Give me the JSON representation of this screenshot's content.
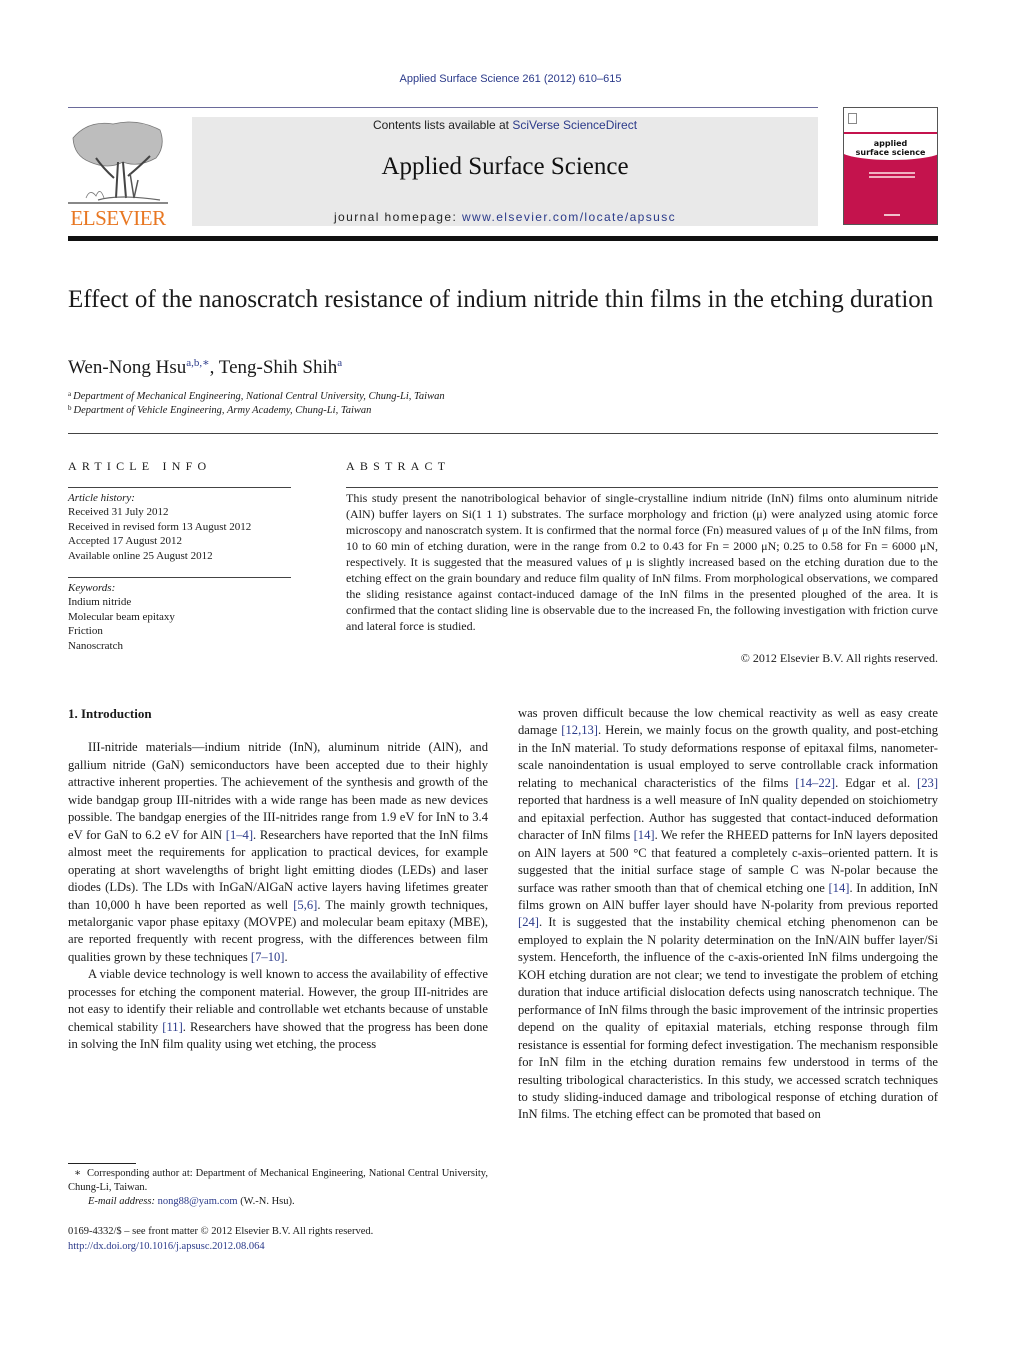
{
  "running_head": "Applied Surface Science 261 (2012) 610–615",
  "masthead": {
    "contents_prefix": "Contents lists available at ",
    "contents_link": "SciVerse ScienceDirect",
    "journal_title": "Applied Surface Science",
    "homepage_prefix": "journal homepage: ",
    "homepage_link": "www.elsevier.com/locate/apsusc",
    "publisher_logo_text": "ELSEVIER",
    "cover_title_line1": "applied",
    "cover_title_line2": "surface science"
  },
  "colors": {
    "link": "#2b3a8a",
    "elsevier_orange": "#e87722",
    "cover_red": "#c4134d",
    "masthead_bg": "#e9e9e9"
  },
  "article": {
    "title": "Effect of the nanoscratch resistance of indium nitride thin films in the etching duration",
    "authors": [
      {
        "name": "Wen-Nong Hsu",
        "marks": "a,b,∗"
      },
      {
        "name": "Teng-Shih Shih",
        "marks": "a"
      }
    ],
    "author_separator": ", ",
    "affiliations": [
      {
        "mark": "a",
        "text": "Department of Mechanical Engineering, National Central University, Chung-Li, Taiwan"
      },
      {
        "mark": "b",
        "text": "Department of Vehicle Engineering, Army Academy, Chung-Li, Taiwan"
      }
    ]
  },
  "article_info": {
    "heading": "ARTICLE INFO",
    "history_label": "Article history:",
    "history": [
      "Received 31 July 2012",
      "Received in revised form 13 August 2012",
      "Accepted 17 August 2012",
      "Available online 25 August 2012"
    ],
    "keywords_label": "Keywords:",
    "keywords": [
      "Indium nitride",
      "Molecular beam epitaxy",
      "Friction",
      "Nanoscratch"
    ]
  },
  "abstract": {
    "heading": "ABSTRACT",
    "text": "This study present the nanotribological behavior of single-crystalline indium nitride (InN) films onto aluminum nitride (AlN) buffer layers on Si(1 1 1) substrates. The surface morphology and friction (μ) were analyzed using atomic force microscopy and nanoscratch system. It is confirmed that the normal force (Fn) measured values of μ of the InN films, from 10 to 60 min of etching duration, were in the range from 0.2 to 0.43 for Fn = 2000 μN; 0.25 to 0.58 for Fn = 6000 μN, respectively. It is suggested that the measured values of μ is slightly increased based on the etching duration due to the etching effect on the grain boundary and reduce film quality of InN films. From morphological observations, we compared the sliding resistance against contact-induced damage of the InN films in the presented ploughed of the area. It is confirmed that the contact sliding line is observable due to the increased Fn, the following investigation with friction curve and lateral force is studied.",
    "copyright": "© 2012 Elsevier B.V. All rights reserved."
  },
  "body": {
    "section_heading": "1.  Introduction",
    "left_paragraphs": [
      "III-nitride materials—indium nitride (InN), aluminum nitride (AlN), and gallium nitride (GaN) semiconductors have been accepted due to their highly attractive inherent properties. The achievement of the synthesis and growth of the wide bandgap group III-nitrides with a wide range has been made as new devices possible. The bandgap energies of the III-nitrides range from 1.9 eV for InN to 3.4 eV for GaN to 6.2 eV for AlN [1–4]. Researchers have reported that the InN films almost meet the requirements for application to practical devices, for example operating at short wavelengths of bright light emitting diodes (LEDs) and laser diodes (LDs). The LDs with InGaN/AlGaN active layers having lifetimes greater than 10,000 h have been reported as well [5,6]. The mainly growth techniques, metalorganic vapor phase epitaxy (MOVPE) and molecular beam epitaxy (MBE), are reported frequently with recent progress, with the differences between film qualities grown by these techniques [7–10].",
      "A viable device technology is well known to access the availability of effective processes for etching the component material. However, the group III-nitrides are not easy to identify their reliable and controllable wet etchants because of unstable chemical stability [11]. Researchers have showed that the progress has been done in solving the InN film quality using wet etching, the process"
    ],
    "right_paragraphs": [
      "was proven difficult because the low chemical reactivity as well as easy create damage [12,13]. Herein, we mainly focus on the growth quality, and post-etching in the InN material. To study deformations response of epitaxal films, nanometer-scale nanoindentation is usual employed to serve controllable crack information relating to mechanical characteristics of the films [14–22]. Edgar et al. [23] reported that hardness is a well measure of InN quality depended on stoichiometry and epitaxial perfection. Author has suggested that contact-induced deformation character of InN films [14]. We refer the RHEED patterns for InN layers deposited on AlN layers at 500 °C that featured a completely c-axis–oriented pattern. It is suggested that the initial surface stage of sample C was N-polar because the surface was rather smooth than that of chemical etching one [14]. In addition, InN films grown on AlN buffer layer should have N-polarity from previous reported [24]. It is suggested that the instability chemical etching phenomenon can be employed to explain the N polarity determination on the InN/AlN buffer layer/Si system. Henceforth, the influence of the c-axis-oriented InN films undergoing the KOH etching duration are not clear; we tend to investigate the problem of etching duration that induce artificial dislocation defects using nanoscratch technique. The performance of InN films through the basic improvement of the intrinsic properties depend on the quality of epitaxial materials, etching response through film resistance is essential for forming defect investigation. The mechanism responsible for InN film in the etching duration remains few understood in terms of the resulting tribological characteristics. In this study, we accessed scratch techniques to study sliding-induced damage and tribological response of etching duration of InN films. The etching effect can be promoted that based on"
    ]
  },
  "footnote": {
    "mark": "∗",
    "corresponding": "Corresponding author at: Department of Mechanical Engineering, National Central University, Chung-Li, Taiwan.",
    "email_label": "E-mail address:",
    "email": "nong88@yam.com",
    "email_suffix": " (W.-N. Hsu).",
    "issn": "0169-4332/$ – see front matter © 2012 Elsevier B.V. All rights reserved.",
    "doi": "http://dx.doi.org/10.1016/j.apsusc.2012.08.064"
  }
}
